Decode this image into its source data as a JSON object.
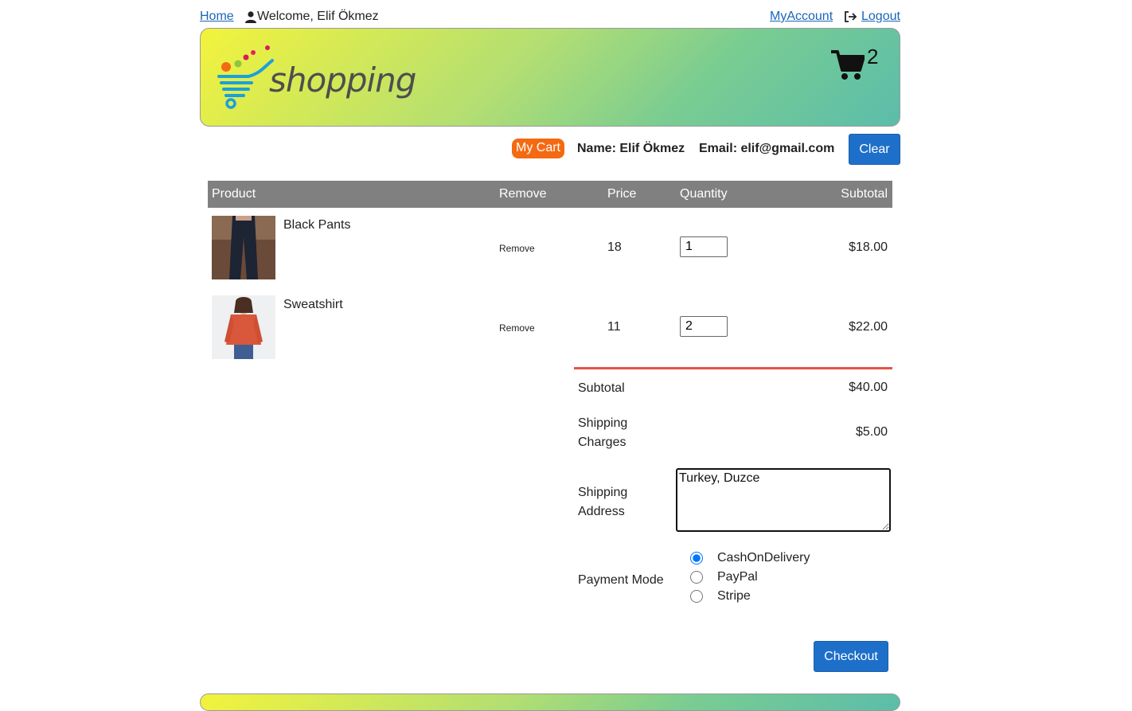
{
  "nav": {
    "home": "Home",
    "welcome": "Welcome, Elif Ökmez",
    "my_account": "MyAccount",
    "logout": "Logout"
  },
  "banner": {
    "logo_text": "shopping",
    "cart_count": "2"
  },
  "user": {
    "my_cart": "My Cart",
    "name": "Name: Elif Ökmez",
    "email": "Email: elif@gmail.com",
    "clear": "Clear"
  },
  "table": {
    "headers": {
      "product": "Product",
      "remove": "Remove",
      "price": "Price",
      "quantity": "Quantity",
      "subtotal": "Subtotal"
    },
    "rows": [
      {
        "name": "Black Pants",
        "remove": "Remove",
        "price": "18",
        "quantity": "1",
        "subtotal": "$18.00"
      },
      {
        "name": "Sweatshirt",
        "remove": "Remove",
        "price": "11",
        "quantity": "2",
        "subtotal": "$22.00"
      }
    ]
  },
  "summary": {
    "subtotal_label": "Subtotal",
    "subtotal_value": "$40.00",
    "shipping_charges_label_1": "Shipping",
    "shipping_charges_label_2": "Charges",
    "shipping_charges_value": "$5.00",
    "shipping_address_label_1": "Shipping",
    "shipping_address_label_2": "Address",
    "shipping_address_value": "Turkey, Duzce",
    "payment_mode_label": "Payment Mode",
    "payment_options": [
      "CashOnDelivery",
      "PayPal",
      "Stripe"
    ],
    "payment_selected": "CashOnDelivery",
    "checkout": "Checkout"
  },
  "colors": {
    "accent_blue": "#1e6fc9",
    "badge_orange": "#f46a13",
    "table_header": "#808080",
    "divider_red": "#e55347",
    "link_blue": "#1a66b8"
  }
}
